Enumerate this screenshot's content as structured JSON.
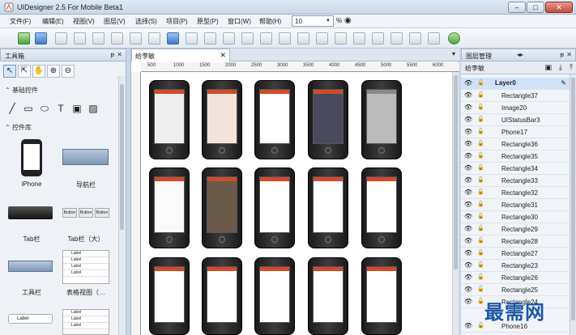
{
  "window": {
    "title": "UIDesigner 2.5 For Mobile Beta1"
  },
  "menubar": {
    "items": [
      "文件(F)",
      "编辑(E)",
      "视图(V)",
      "图层(V)",
      "选择(S)",
      "项目(P)",
      "原型(P)",
      "窗口(W)",
      "帮助(H)"
    ],
    "zoom_value": "10",
    "zoom_unit": "%"
  },
  "toolbox": {
    "title": "工具箱",
    "section_basic": "基础控件",
    "section_library": "控件库",
    "controls": [
      "iPhone",
      "导航栏",
      "Tab栏",
      "Tab栏（大）",
      "工具栏",
      "表格视图（…"
    ],
    "navbar_buttons": [
      "Button",
      "Button",
      "Button"
    ],
    "list_label": "Label",
    "bottom_label": "Label"
  },
  "document": {
    "tab": "给李敏",
    "ruler": [
      "500",
      "1000",
      "1500",
      "2000",
      "2500",
      "3000",
      "3500",
      "4000",
      "4500",
      "5000",
      "5500",
      "6000"
    ]
  },
  "layers": {
    "title": "图层管理",
    "doc": "给李敏",
    "layer_name": "Layer0",
    "items": [
      "Rectangle37",
      "Image20",
      "UIStatusBar3",
      "Phone17",
      "Rectangle36",
      "Rectangle35",
      "Rectangle34",
      "Rectangle33",
      "Rectangle32",
      "Rectangle31",
      "Rectangle30",
      "Rectangle29",
      "Rectangle28",
      "Rectangle27",
      "Rectangle23",
      "Rectangle26",
      "Rectangle25",
      "Rectangle24",
      "Phone16"
    ]
  },
  "watermark": "最需网",
  "colors": {
    "accent": "#d24a2a",
    "selection": "#cfe2f7",
    "chrome": "#c9d6e6"
  }
}
